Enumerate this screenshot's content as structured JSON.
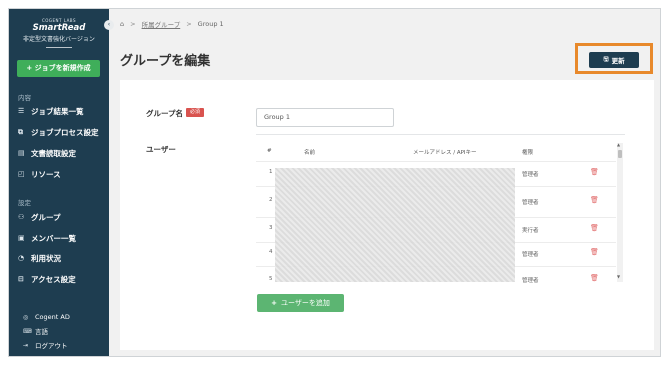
{
  "sidebar": {
    "logo_top": "COGENT LABS",
    "logo_main": "SmartRead",
    "logo_sub": "非定型文書強化バージョン",
    "new_job": "+ ジョブを新規作成",
    "section_content": "内容",
    "content_items": [
      {
        "icon": "list-icon",
        "label": "ジョブ結果一覧"
      },
      {
        "icon": "process-icon",
        "label": "ジョブプロセス設定"
      },
      {
        "icon": "document-icon",
        "label": "文書読取設定"
      },
      {
        "icon": "resource-icon",
        "label": "リソース"
      }
    ],
    "section_settings": "設定",
    "settings_items": [
      {
        "icon": "group-icon",
        "label": "グループ"
      },
      {
        "icon": "member-icon",
        "label": "メンバー一覧"
      },
      {
        "icon": "usage-icon",
        "label": "利用状況"
      },
      {
        "icon": "access-icon",
        "label": "アクセス設定"
      }
    ],
    "footer": {
      "org": "Cogent AD",
      "language": "言語",
      "logout": "ログアウト"
    }
  },
  "breadcrumb": {
    "parent": "所属グループ",
    "current": "Group 1"
  },
  "page_title": "グループを編集",
  "update_button": "更新",
  "form": {
    "group_name_label": "グループ名",
    "required_badge": "必須",
    "group_name_value": "Group 1",
    "users_label": "ユーザー"
  },
  "users_table": {
    "headers": {
      "num": "#",
      "name": "名前",
      "email": "メールアドレス / APIキー",
      "role": "権限"
    },
    "rows": [
      {
        "num": "1",
        "role": "管理者"
      },
      {
        "num": "2",
        "role": "管理者"
      },
      {
        "num": "3",
        "role": "実行者"
      },
      {
        "num": "4",
        "role": "管理者"
      },
      {
        "num": "5",
        "role": "管理者"
      }
    ]
  },
  "add_user_button": "ユーザーを追加",
  "colors": {
    "sidebar": "#1e3d50",
    "accent_green": "#3fae5a",
    "highlight": "#e8892b",
    "danger": "#d9534f"
  }
}
